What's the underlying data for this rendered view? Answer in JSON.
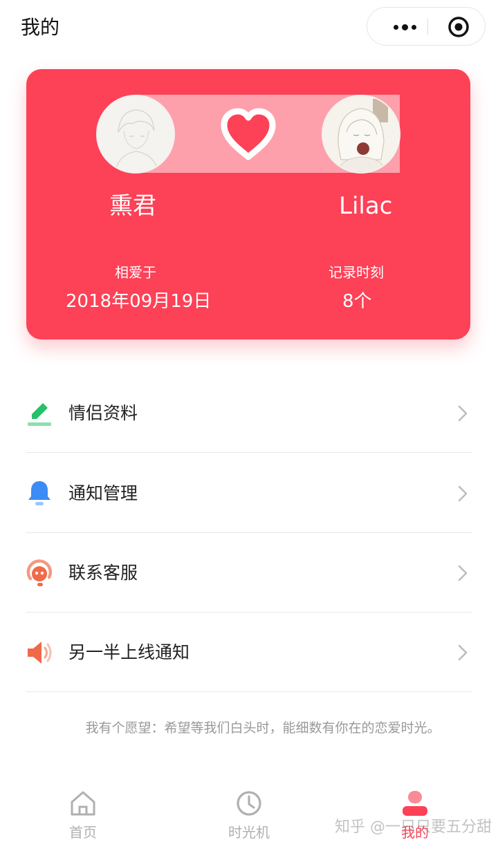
{
  "header": {
    "title": "我的"
  },
  "capsule": {
    "more_icon": "more-dots-icon",
    "close_icon": "target-icon"
  },
  "couple": {
    "left_name": "熏君",
    "right_name": "Lilac",
    "center_icon": "heart-icon",
    "since_label": "相爱于",
    "since_value": "2018年09月19日",
    "records_label": "记录时刻",
    "records_value": "8个",
    "card_color": "#fd4157"
  },
  "menu": {
    "items": [
      {
        "label": "情侣资料",
        "icon": "edit-icon",
        "color": "#27c16b"
      },
      {
        "label": "通知管理",
        "icon": "bell-icon",
        "color": "#3b8cf4"
      },
      {
        "label": "联系客服",
        "icon": "customer-service-icon",
        "color": "#f06a4a"
      },
      {
        "label": "另一半上线通知",
        "icon": "speaker-icon",
        "color": "#f06a4a"
      }
    ]
  },
  "wish": {
    "text": "我有个愿望：希望等我们白头时，能细数有你在的恋爱时光。"
  },
  "tabbar": {
    "items": [
      {
        "label": "首页",
        "icon": "home-icon"
      },
      {
        "label": "时光机",
        "icon": "clock-icon"
      },
      {
        "label": "我的",
        "icon": "user-icon",
        "active": true
      }
    ]
  },
  "watermark": {
    "text": "知乎 @一只只要五分甜"
  }
}
